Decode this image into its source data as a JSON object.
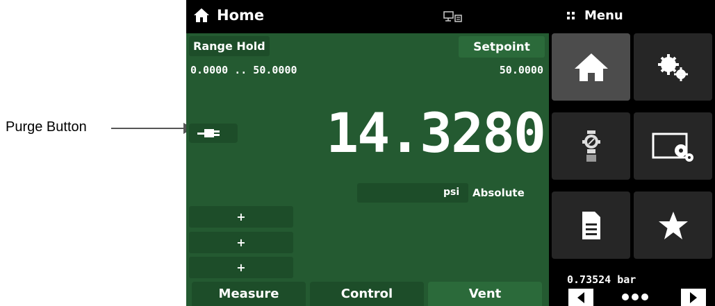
{
  "callout": {
    "label": "Purge Button"
  },
  "header": {
    "home_label": "Home",
    "menu_label": "Menu"
  },
  "range": {
    "label": "Range Hold",
    "values": "0.0000 .. 50.0000"
  },
  "setpoint": {
    "label": "Setpoint",
    "value": "50.0000"
  },
  "reading": {
    "value": "14.3280",
    "unit": "psi",
    "mode": "Absolute"
  },
  "plus_buttons": [
    "+",
    "+",
    "+"
  ],
  "tabs": {
    "measure": "Measure",
    "control": "Control",
    "vent": "Vent"
  },
  "menu": {
    "icons": [
      "home-icon",
      "settings-gears-icon",
      "regulator-icon",
      "display-settings-icon",
      "document-icon",
      "star-icon"
    ],
    "secondary_reading": "0.73524  bar"
  },
  "colors": {
    "panel_green": "#245a31",
    "dark_green": "#1d4d29",
    "active_green": "#2b6a3a",
    "menu_selected": "#4c4c4c"
  }
}
